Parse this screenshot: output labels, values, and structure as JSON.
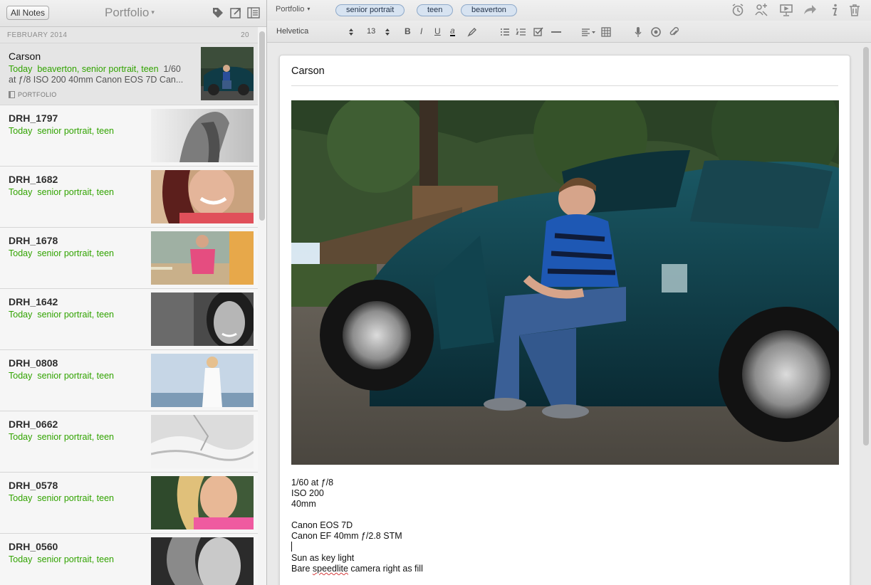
{
  "left_header": {
    "all_notes_label": "All Notes",
    "notebook_title": "Portfolio",
    "caret": "▾"
  },
  "list": {
    "month": "FEBRUARY 2014",
    "count": "20",
    "selected": {
      "title": "Carson",
      "date": "Today",
      "tags": "beaverton, senior portrait, teen",
      "snippet_line1_rest": "1/60",
      "snippet_line2": "at ƒ/8 ISO 200 40mm Canon EOS 7D Can...",
      "notebook": "PORTFOLIO"
    },
    "notes": [
      {
        "title": "DRH_1797",
        "date": "Today",
        "tags": "senior portrait, teen"
      },
      {
        "title": "DRH_1682",
        "date": "Today",
        "tags": "senior portrait, teen"
      },
      {
        "title": "DRH_1678",
        "date": "Today",
        "tags": "senior portrait, teen"
      },
      {
        "title": "DRH_1642",
        "date": "Today",
        "tags": "senior portrait, teen"
      },
      {
        "title": "DRH_0808",
        "date": "Today",
        "tags": "senior portrait, teen"
      },
      {
        "title": "DRH_0662",
        "date": "Today",
        "tags": "senior portrait, teen"
      },
      {
        "title": "DRH_0578",
        "date": "Today",
        "tags": "senior portrait, teen"
      },
      {
        "title": "DRH_0560",
        "date": "Today",
        "tags": "senior portrait, teen"
      }
    ]
  },
  "editor_toolbar": {
    "notebook": "Portfolio",
    "caret": "▾",
    "tags": [
      "senior portrait",
      "teen",
      "beaverton"
    ],
    "font": "Helvetica",
    "size": "13",
    "stepper": "▲▼",
    "bold": "B",
    "italic": "I",
    "underline": "U",
    "text_color": "a"
  },
  "note": {
    "title": "Carson",
    "body": [
      "1/60 at ƒ/8",
      "ISO 200",
      "40mm",
      "",
      "Canon EOS 7D",
      "Canon EF 40mm ƒ/2.8 STM",
      "",
      "Sun as key light",
      "Bare",
      "speedlite",
      "camera right as fill"
    ]
  },
  "colors": {
    "tag_green": "#31a300",
    "tag_pill_fill": "#d7e3f1",
    "tag_pill_border": "#8ea9c9",
    "car_teal": "#0f3b46"
  },
  "icons": [
    "tag-icon",
    "share-icon",
    "view-toggle-icon",
    "reminder-icon",
    "work-chat-icon",
    "presentation-icon",
    "forward-icon",
    "info-icon",
    "trash-icon",
    "highlighter-icon",
    "bullet-list-icon",
    "numbered-list-icon",
    "checkbox-icon",
    "horizontal-rule-icon",
    "align-icon",
    "table-icon",
    "microphone-icon",
    "camera-icon",
    "attachment-icon"
  ]
}
